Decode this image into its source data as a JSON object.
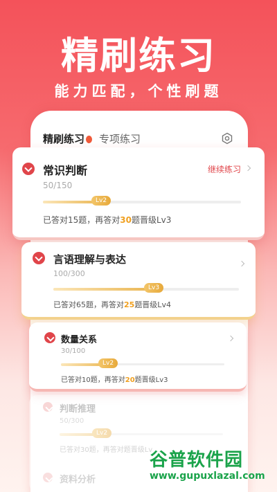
{
  "hero": {
    "title": "精刷练习",
    "subtitle": "能力匹配，个性刷题"
  },
  "tabs": {
    "active": "精刷练习",
    "other": "专项练习"
  },
  "cards": [
    {
      "title": "常识判断",
      "count": "50/150",
      "progress": 0.33,
      "level": "Lv2",
      "note_prefix": "已答对15题，再答对",
      "note_num": "30",
      "note_suffix": "题晋级Lv3",
      "action": "继续练习"
    },
    {
      "title": "言语理解与表达",
      "count": "100/300",
      "progress": 0.58,
      "level": "Lv3",
      "note_prefix": "已答对65题，再答对",
      "note_num": "25",
      "note_suffix": "题晋级Lv4"
    },
    {
      "title": "数量关系",
      "count": "30/100",
      "progress": 0.33,
      "level": "Lv2",
      "note_prefix": "已答对10题，再答对",
      "note_num": "20",
      "note_suffix": "题晋级Lv3"
    },
    {
      "title": "判断推理",
      "count": "50/300",
      "progress": 0.3,
      "level": "Lv2",
      "note_prefix": "已答对30题，再答对",
      "note_num": "",
      "note_suffix": "题晋级Lv"
    },
    {
      "title": "资料分析"
    }
  ],
  "watermark": {
    "name": "谷普软件园",
    "url": "www.gupuxlazal.com"
  },
  "colors": {
    "accent": "#e0454a",
    "gold": "#e9b24a",
    "brand_green": "#1aa34a"
  },
  "icons": {
    "settings": "settings-icon",
    "chevron": "chevron-down-icon",
    "arrow": "chevron-right-icon"
  }
}
